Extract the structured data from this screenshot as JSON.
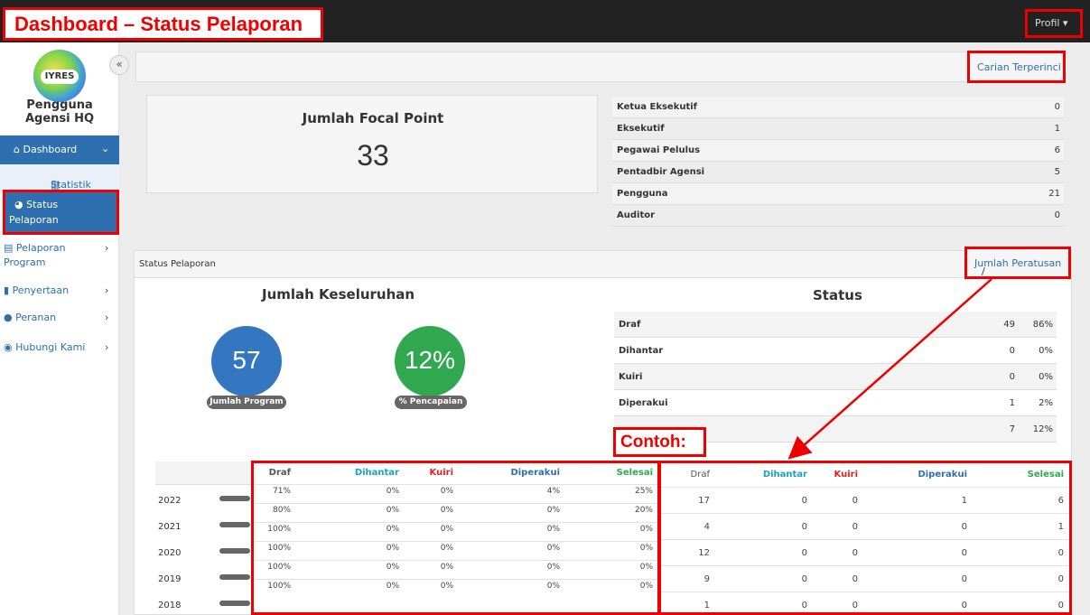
{
  "header": {
    "title": "Dashboard – Status Pelaporan",
    "profile_label": "Profil ▾"
  },
  "sidebar": {
    "logo_text": "IYRES",
    "collapse_glyph": "«",
    "user_name": "Pengguna Agensi HQ",
    "items": [
      {
        "label": "Dashboard",
        "icon": "home-icon"
      },
      {
        "label": "Statistik",
        "icon": "chart-icon"
      },
      {
        "label_line1": "Status",
        "label_line2": "Pelaporan",
        "icon": "pie-icon"
      },
      {
        "label": "Pelaporan Program",
        "icon": "report-icon"
      },
      {
        "label": "Penyertaan",
        "icon": "file-icon"
      },
      {
        "label": "Peranan",
        "icon": "user-icon"
      },
      {
        "label": "Hubungi Kami",
        "icon": "chat-icon"
      }
    ]
  },
  "search": {
    "link_label": "Carian Terperinci"
  },
  "focal_point": {
    "title": "Jumlah Focal Point",
    "value": "33"
  },
  "roles": [
    {
      "label": "Ketua Eksekutif",
      "value": "0"
    },
    {
      "label": "Eksekutif",
      "value": "1"
    },
    {
      "label": "Pegawai Pelulus",
      "value": "6"
    },
    {
      "label": "Pentadbir Agensi",
      "value": "5"
    },
    {
      "label": "Pengguna",
      "value": "21"
    },
    {
      "label": "Auditor",
      "value": "0"
    }
  ],
  "status_panel": {
    "title": "Status Pelaporan",
    "toggle_jumlah": "Jumlah",
    "toggle_sep": "/",
    "toggle_peratusan": "Peratusan",
    "overall_title": "Jumlah Keseluruhan",
    "total_programs": "57",
    "total_programs_label": "Jumlah Program",
    "achievement": "12%",
    "achievement_label": "% Pencapaian",
    "status_title": "Status",
    "status_rows": [
      {
        "label": "Draf",
        "count": "49",
        "pct": "86%"
      },
      {
        "label": "Dihantar",
        "count": "0",
        "pct": "0%"
      },
      {
        "label": "Kuiri",
        "count": "0",
        "pct": "0%"
      },
      {
        "label": "Diperakui",
        "count": "1",
        "pct": "2%"
      },
      {
        "label": "",
        "count": "7",
        "pct": "12%"
      }
    ],
    "example_label": "Contoh:"
  },
  "yearly": {
    "headers": [
      "Draf",
      "Dihantar",
      "Kuiri",
      "Diperakui",
      "Selesai"
    ],
    "years": [
      "2022",
      "2021",
      "2020",
      "2019",
      "2018"
    ],
    "percent_rows": [
      [
        "71%",
        "0%",
        "0%",
        "4%",
        "25%"
      ],
      [
        "80%",
        "0%",
        "0%",
        "0%",
        "20%"
      ],
      [
        "100%",
        "0%",
        "0%",
        "0%",
        "0%"
      ],
      [
        "100%",
        "0%",
        "0%",
        "0%",
        "0%"
      ],
      [
        "100%",
        "0%",
        "0%",
        "0%",
        "0%"
      ],
      [
        "100%",
        "0%",
        "0%",
        "0%",
        "0%"
      ]
    ],
    "count_rows": [
      [
        "17",
        "0",
        "0",
        "1",
        "6"
      ],
      [
        "4",
        "0",
        "0",
        "0",
        "1"
      ],
      [
        "12",
        "0",
        "0",
        "0",
        "0"
      ],
      [
        "9",
        "0",
        "0",
        "0",
        "0"
      ],
      [
        "1",
        "0",
        "0",
        "0",
        "0"
      ]
    ]
  },
  "colors": {
    "accent": "#2e6fb0",
    "highlight": "#e00000",
    "success": "#2fa84f",
    "dihantar": "#1aa3b8",
    "kuiri": "#e02020"
  }
}
